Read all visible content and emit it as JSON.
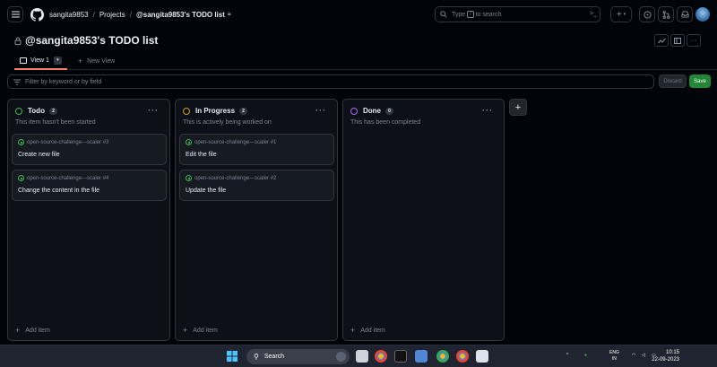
{
  "header": {
    "menu_icon": "hamburger-icon",
    "logo": "github-logo",
    "crumbs": [
      "sangita9853",
      "Projects",
      "@sangita9853's TODO list"
    ],
    "search_placeholder_before": "Type",
    "search_key": "/",
    "search_placeholder_after": "to search",
    "right_icons": [
      "terminal-icon",
      "plus-icon",
      "issues-icon",
      "pull-requests-icon",
      "inbox-icon",
      "avatar"
    ]
  },
  "project": {
    "title": "@sangita9853's TODO list",
    "tools": [
      "insights-icon",
      "panel-icon",
      "more-icon"
    ],
    "more_label": "···"
  },
  "tabs": {
    "active": "View 1",
    "new_view": "New View",
    "caret": "▾"
  },
  "filter": {
    "placeholder": "Filter by keyword or by field",
    "discard": "Discard",
    "save": "Save"
  },
  "columns": [
    {
      "name": "Todo",
      "count": "2",
      "color": "#3fb950",
      "description": "This item hasn't been started",
      "menu": "···",
      "cards": [
        {
          "repo": "open-source-challenge---scaler #3",
          "title": "Create new file"
        },
        {
          "repo": "open-source-challenge---scaler #4",
          "title": "Change the content in the file"
        }
      ],
      "add_label": "Add item"
    },
    {
      "name": "In Progress",
      "count": "2",
      "color": "#d29922",
      "description": "This is actively being worked on",
      "menu": "···",
      "cards": [
        {
          "repo": "open-source-challenge---scaler #1",
          "title": "Edit the file"
        },
        {
          "repo": "open-source-challenge---scaler #2",
          "title": "Update the file"
        }
      ],
      "add_label": "Add item"
    },
    {
      "name": "Done",
      "count": "0",
      "color": "#a371f7",
      "description": "This has been completed",
      "menu": "···",
      "cards": [],
      "add_label": "Add item"
    }
  ],
  "add_column": "+",
  "taskbar": {
    "search_label": "Search",
    "language": "ENG",
    "region": "IN",
    "time": "10:15",
    "date": "22-09-2023"
  }
}
